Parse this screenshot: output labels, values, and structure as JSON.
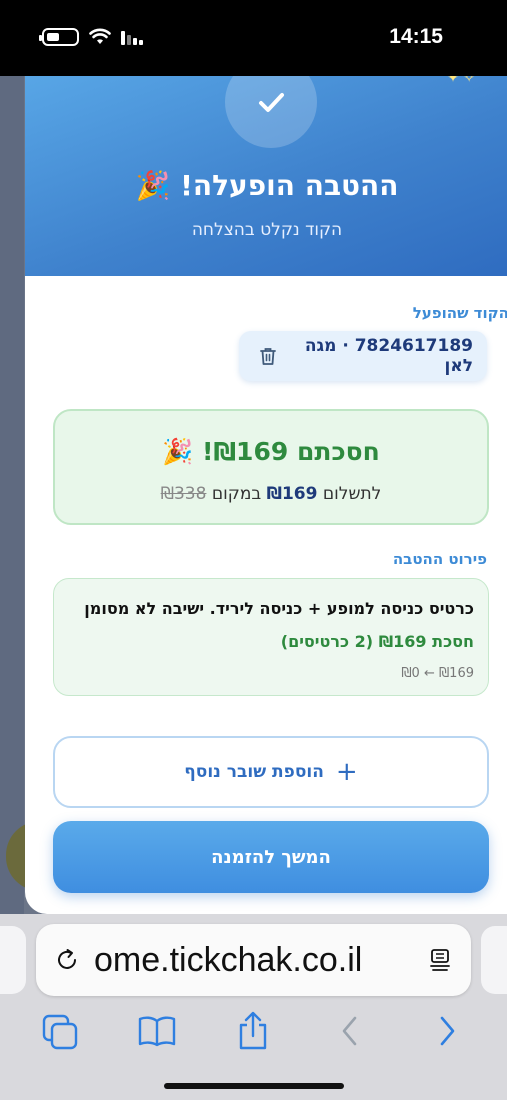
{
  "status_bar": {
    "time": "14:15"
  },
  "modal": {
    "title": "ההטבה הופעלה! 🎉",
    "subtitle": "הקוד נקלט בהצלחה",
    "applied_code_label": "הקוד שהופעל",
    "applied_code": "7824617189 · מגה לאן",
    "savings": {
      "title": "חסכתם ₪169! 🎉",
      "pay_prefix": "לתשלום",
      "pay_amount": "₪169",
      "instead_of": "במקום",
      "original_price": "₪338"
    },
    "details_label": "פירוט ההטבה",
    "details": {
      "description": "כרטיס כניסה למופע + כניסה ליריד. ישיבה לא מסומן",
      "saving_text": "חסכת ₪169 (2 כרטיסים)",
      "price_change": "₪169 ← ₪0"
    },
    "add_voucher_label": "הוספת שובר נוסף",
    "continue_label": "המשך להזמנה"
  },
  "browser": {
    "url": "ome.tickchak.co.il"
  },
  "colors": {
    "header_gradient": "#3f82cd",
    "accent_blue": "#3d8bd6",
    "success_green": "#2e8a3e"
  }
}
